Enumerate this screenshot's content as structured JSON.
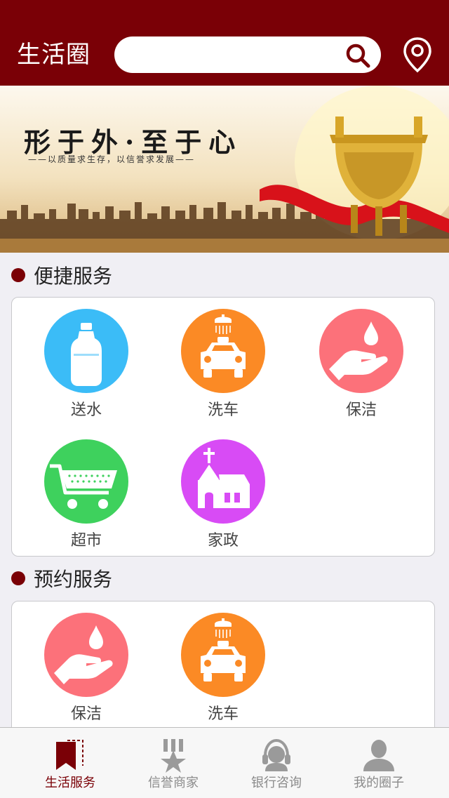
{
  "header": {
    "title": "生活圈",
    "search_placeholder": "",
    "search_icon": "search-icon",
    "location_icon": "location-pin-icon"
  },
  "banner": {
    "title": "形于外·至于心",
    "subtitle": "——以质量求生存，以信誉求发展——"
  },
  "quick_services": {
    "title": "便捷服务",
    "items": [
      {
        "label": "送水",
        "icon": "water-bottle-icon",
        "color": "#3bbcf7"
      },
      {
        "label": "洗车",
        "icon": "car-wash-icon",
        "color": "#fb8a25"
      },
      {
        "label": "保洁",
        "icon": "cleaning-hand-icon",
        "color": "#fc717a"
      },
      {
        "label": "超市",
        "icon": "shopping-cart-icon",
        "color": "#3ed15d"
      },
      {
        "label": "家政",
        "icon": "house-icon",
        "color": "#d84bf5"
      }
    ]
  },
  "booking_services": {
    "title": "预约服务",
    "items": [
      {
        "label": "保洁",
        "icon": "cleaning-hand-icon",
        "color": "#fc717a"
      },
      {
        "label": "洗车",
        "icon": "car-wash-icon",
        "color": "#fb8a25"
      }
    ]
  },
  "tabbar": {
    "active_color": "#7a0006",
    "items": [
      {
        "label": "生活服务",
        "icon": "bookmark-icon",
        "active": true
      },
      {
        "label": "信誉商家",
        "icon": "medal-star-icon",
        "active": false
      },
      {
        "label": "银行咨询",
        "icon": "headset-icon",
        "active": false
      },
      {
        "label": "我的圈子",
        "icon": "user-icon",
        "active": false
      }
    ]
  }
}
